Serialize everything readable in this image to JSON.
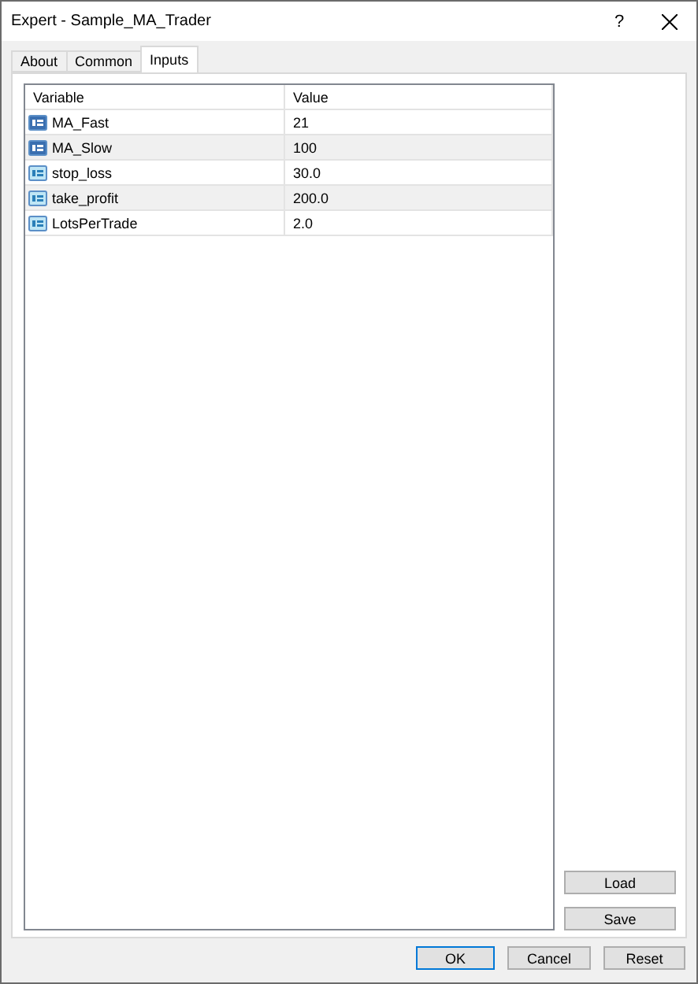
{
  "window": {
    "title": "Expert - Sample_MA_Trader",
    "help": "?"
  },
  "tabs": [
    {
      "label": "About",
      "selected": false
    },
    {
      "label": "Common",
      "selected": false
    },
    {
      "label": "Inputs",
      "selected": true
    }
  ],
  "table": {
    "columns": [
      "Variable",
      "Value"
    ],
    "rows": [
      {
        "kind": "int",
        "variable": "MA_Fast",
        "value": "21"
      },
      {
        "kind": "int",
        "variable": "MA_Slow",
        "value": "100"
      },
      {
        "kind": "double",
        "variable": "stop_loss",
        "value": "30.0"
      },
      {
        "kind": "double",
        "variable": "take_profit",
        "value": "200.0"
      },
      {
        "kind": "double",
        "variable": "LotsPerTrade",
        "value": "2.0"
      }
    ]
  },
  "side_buttons": [
    "Load",
    "Save"
  ],
  "buttons": [
    {
      "label": "OK",
      "default": true
    },
    {
      "label": "Cancel",
      "default": false
    },
    {
      "label": "Reset",
      "default": false
    }
  ]
}
